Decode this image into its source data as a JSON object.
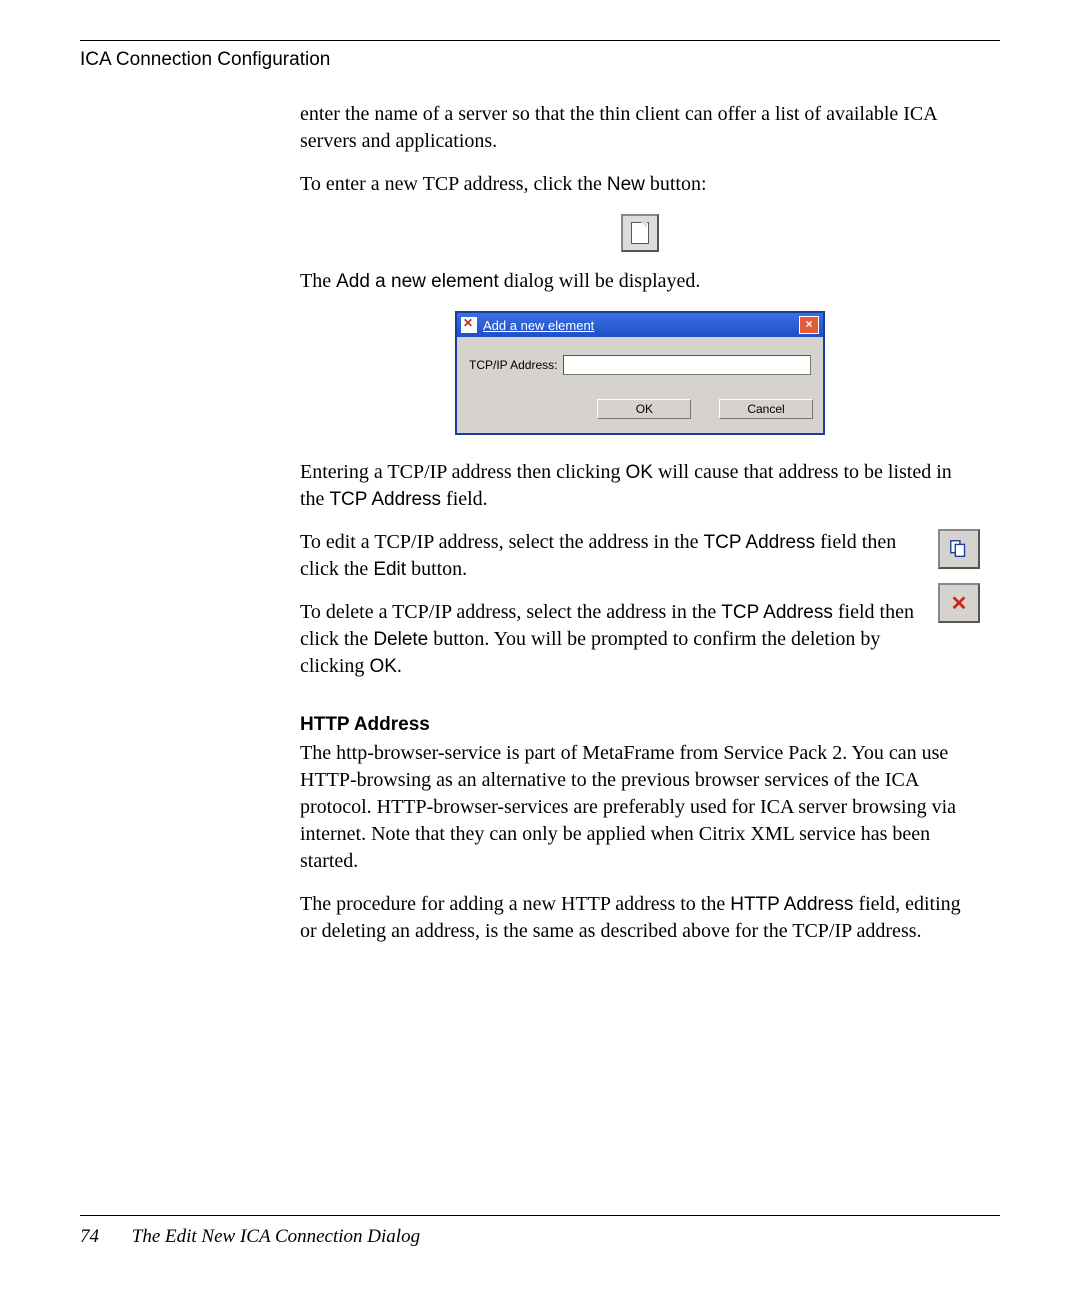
{
  "header": {
    "title": "ICA Connection Configuration"
  },
  "paras": {
    "p1": "enter the name of a server so that the thin client can offer a list of available ICA servers and applications.",
    "p2a": "To enter a new TCP address, click the ",
    "p2b": "New",
    "p2c": " button:",
    "p3a": "The ",
    "p3b": "Add a new element",
    "p3c": " dialog will be displayed.",
    "p4a": "Entering a TCP/IP address then clicking ",
    "p4b": "OK",
    "p4c": " will cause that address to be listed in the ",
    "p4d": "TCP Address",
    "p4e": " field.",
    "p5a": "To edit a TCP/IP address, select the address in the ",
    "p5b": "TCP Address",
    "p5c": " field then click the ",
    "p5d": "Edit",
    "p5e": " button.",
    "p6a": "To delete a TCP/IP address, select the address in the ",
    "p6b": "TCP Address",
    "p6c": " field then click the ",
    "p6d": "Delete",
    "p6e": " button. You will be prompted to confirm the deletion by clicking ",
    "p6f": "OK",
    "p6g": ".",
    "http_heading": "HTTP Address",
    "p7": "The http-browser-service is part of MetaFrame from Service Pack 2. You can use HTTP-browsing as an alternative to the previous browser services of the ICA protocol. HTTP-browser-services are preferably used for ICA server browsing via internet. Note that they can only be applied when Citrix XML service has been started.",
    "p8a": "The procedure for adding a new HTTP address to the ",
    "p8b": "HTTP Address",
    "p8c": " field, editing or deleting an address, is the same as described above for the TCP/IP address."
  },
  "dialog": {
    "title": "Add a new element",
    "label": "TCP/IP Address:",
    "ok": "OK",
    "cancel": "Cancel"
  },
  "footer": {
    "page": "74",
    "section": "The Edit New ICA Connection Dialog"
  }
}
